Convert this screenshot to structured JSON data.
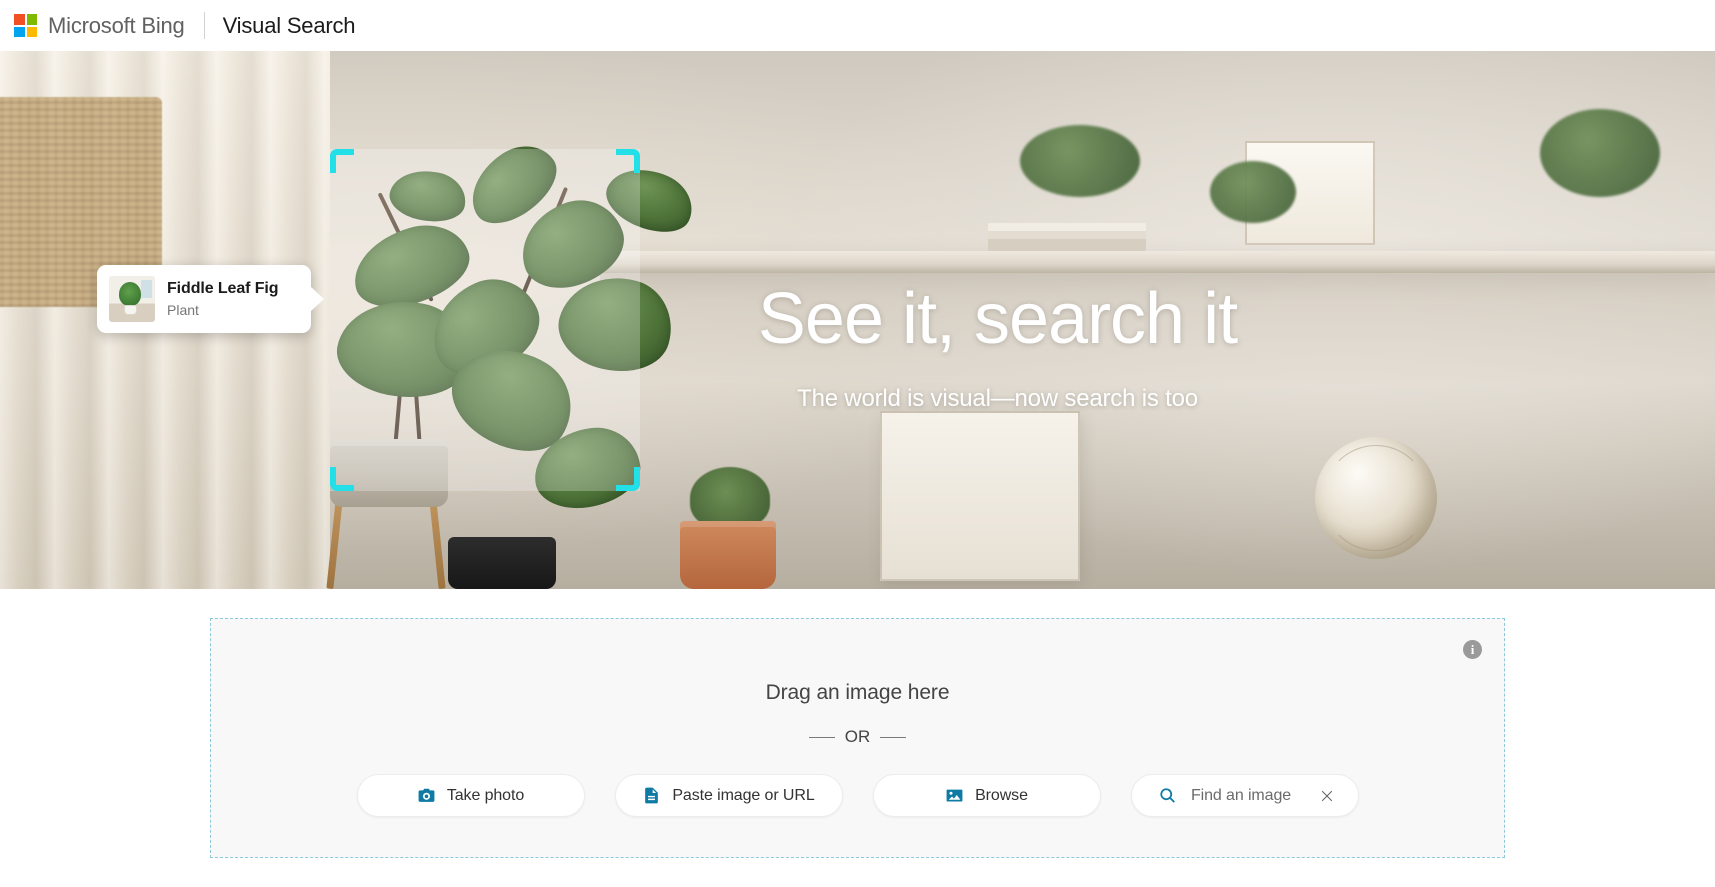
{
  "header": {
    "logo_icon": "microsoft-logo-icon",
    "brand": "Microsoft Bing",
    "page_title": "Visual Search",
    "logo_colors": [
      "#f25022",
      "#7fba00",
      "#00a4ef",
      "#ffb900"
    ]
  },
  "hero": {
    "headline": "See it, search it",
    "subheadline": "The world is visual—now search is too",
    "selection_color": "#22dfe8",
    "entity_card": {
      "title": "Fiddle Leaf Fig",
      "subtitle": "Plant",
      "thumbnail_icon": "plant-thumbnail-icon"
    }
  },
  "dropzone": {
    "drag_label": "Drag an image here",
    "or_label": "— OR —",
    "or_text": "OR",
    "info_icon": "info-icon",
    "info_glyph": "i",
    "border_color": "#8ec8dc",
    "buttons": [
      {
        "label": "Take photo",
        "icon": "camera-icon"
      },
      {
        "label": "Paste image or URL",
        "icon": "document-icon"
      },
      {
        "label": "Browse",
        "icon": "image-icon"
      }
    ],
    "search_field": {
      "placeholder": "Find an image",
      "value": "",
      "search_icon": "search-icon",
      "clear_icon": "close-icon"
    },
    "accent_color": "#0f7ba5"
  }
}
